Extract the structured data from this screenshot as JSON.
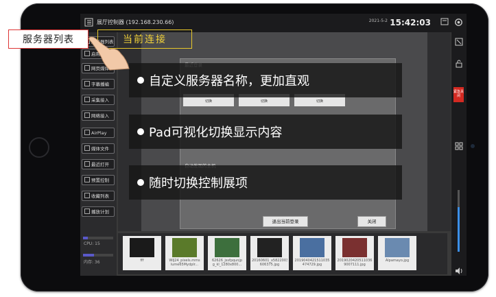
{
  "app": {
    "title": "展厅控制器 (192.168.230.66)",
    "date": "2021-5-2",
    "time": "15:42:03"
  },
  "sidebar": {
    "items": [
      {
        "label": "服务器列表"
      },
      {
        "label": "启用程序"
      },
      {
        "label": "网页媒体"
      },
      {
        "label": "字幕播编"
      },
      {
        "label": "采集接入"
      },
      {
        "label": "网络接入"
      },
      {
        "label": "AirPlay"
      },
      {
        "label": "媒体文件"
      },
      {
        "label": "最近打开"
      },
      {
        "label": "预置控制"
      },
      {
        "label": "收藏列表"
      },
      {
        "label": "播放计划"
      }
    ],
    "cpu": {
      "label": "CPU: 15",
      "value": 0.15
    },
    "mem": {
      "label": "内存: 36",
      "value": 0.36
    }
  },
  "dialog": {
    "recent_title": "最近登录",
    "cards": [
      {
        "btn": "切换"
      },
      {
        "btn": "切换"
      },
      {
        "btn": "切换"
      }
    ],
    "found_title": "自动发现的主机",
    "logout_label": "退出当前登录",
    "close_label": "关闭"
  },
  "overlays": [
    {
      "text": "自定义服务器名称，更加直观"
    },
    {
      "text": "Pad可视化切换显示内容"
    },
    {
      "text": "随时切换控制展项"
    }
  ],
  "callouts": {
    "server_list": "服务器列表",
    "current_connection": "当前连接"
  },
  "thumbnails": [
    {
      "caption": "fff",
      "color": "#1a1a1a"
    },
    {
      "caption": "WIJ24_pixels.mms lume65Mydplr...",
      "color": "#5a7a2a"
    },
    {
      "caption": "62626_jssfpqunjp g_kl_1280x800...",
      "color": "#3d6f3d"
    },
    {
      "caption": "20160601_x5822003 606375.jpg",
      "color": "#222222"
    },
    {
      "caption": "2019040421511035 474729.jpg",
      "color": "#4a6fa0"
    },
    {
      "caption": "2019020420511036 9007111.jpg",
      "color": "#7a3030"
    },
    {
      "caption": "Alpamayo.jpg",
      "color": "#6a8ab0"
    }
  ],
  "volume": {
    "value": 0.72
  },
  "colors": {
    "accent": "#5a59c9",
    "urgent": "#d42a22",
    "highlight": "#f2d23a",
    "callout_border": "#dd3333"
  },
  "urgent_label": "紧急关闭"
}
